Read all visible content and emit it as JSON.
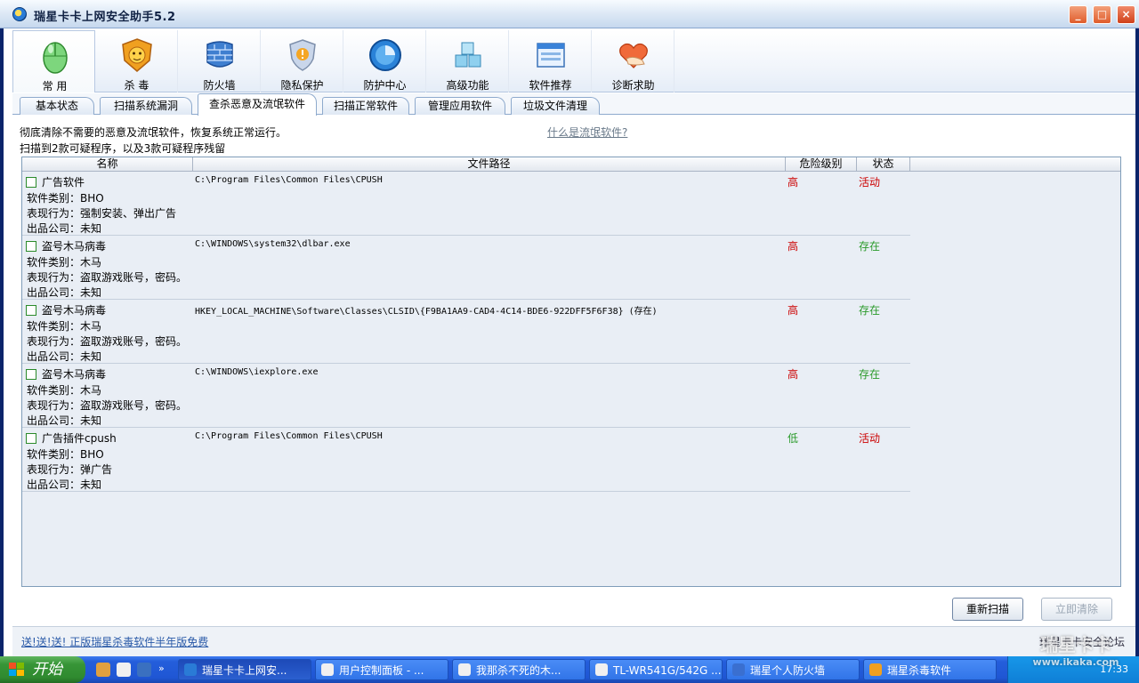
{
  "window": {
    "title": "瑞星卡卡上网安全助手5.2"
  },
  "toolbar": [
    {
      "label": "常  用",
      "icon": "mouse-icon"
    },
    {
      "label": "杀  毒",
      "icon": "lion-icon"
    },
    {
      "label": "防火墙",
      "icon": "firewall-icon"
    },
    {
      "label": "隐私保护",
      "icon": "shield-icon"
    },
    {
      "label": "防护中心",
      "icon": "globe-icon"
    },
    {
      "label": "高级功能",
      "icon": "cubes-icon"
    },
    {
      "label": "软件推荐",
      "icon": "window-icon"
    },
    {
      "label": "诊断求助",
      "icon": "heart-hand-icon"
    }
  ],
  "tabs": [
    {
      "label": "基本状态"
    },
    {
      "label": "扫描系统漏洞"
    },
    {
      "label": "查杀恶意及流氓软件",
      "active": true
    },
    {
      "label": "扫描正常软件"
    },
    {
      "label": "管理应用软件"
    },
    {
      "label": "垃圾文件清理"
    }
  ],
  "content": {
    "description": "彻底清除不需要的恶意及流氓软件，恢复系统正常运行。",
    "help_link": "什么是流氓软件?",
    "scan_summary": "扫描到2款可疑程序，以及3款可疑程序残留"
  },
  "table": {
    "headers": {
      "name": "名称",
      "path": "文件路径",
      "level": "危险级别",
      "state": "状态"
    },
    "rows": [
      {
        "name": "广告软件",
        "type": "软件类别：BHO",
        "behavior": "表现行为：强制安装、弹出广告",
        "company": "出品公司：未知",
        "path": "C:\\Program Files\\Common Files\\CPUSH",
        "level": "高",
        "state": "活动"
      },
      {
        "name": "盗号木马病毒",
        "type": "软件类别：木马",
        "behavior": "表现行为：盗取游戏账号，密码。",
        "company": "出品公司：未知",
        "path": "C:\\WINDOWS\\system32\\dlbar.exe",
        "level": "高",
        "state": "存在"
      },
      {
        "name": "盗号木马病毒",
        "type": "软件类别：木马",
        "behavior": "表现行为：盗取游戏账号，密码。",
        "company": "出品公司：未知",
        "path": "HKEY_LOCAL_MACHINE\\Software\\Classes\\CLSID\\{F9BA1AA9-CAD4-4C14-BDE6-922DFF5F6F38} (存在)",
        "level": "高",
        "state": "存在"
      },
      {
        "name": "盗号木马病毒",
        "type": "软件类别：木马",
        "behavior": "表现行为：盗取游戏账号，密码。",
        "company": "出品公司：未知",
        "path": "C:\\WINDOWS\\iexplore.exe",
        "level": "高",
        "state": "存在"
      },
      {
        "name": "广告插件cpush",
        "type": "软件类别：BHO",
        "behavior": "表现行为：弹广告",
        "company": "出品公司：未知",
        "path": "C:\\Program Files\\Common Files\\CPUSH",
        "level": "低",
        "state": "活动"
      }
    ]
  },
  "buttons": {
    "rescan": "重新扫描",
    "clean": "立即清除"
  },
  "footer": {
    "promo": "送!送!送! 正版瑞星杀毒软件半年版免费",
    "forum": "瑞星卡卡安全论坛"
  },
  "taskbar": {
    "start": "开始",
    "tasks": [
      {
        "label": "瑞星卡卡上网安..."
      },
      {
        "label": "用户控制面板 - ..."
      },
      {
        "label": "我那杀不死的木..."
      },
      {
        "label": "TL-WR541G/542G ..."
      },
      {
        "label": "瑞星个人防火墙"
      },
      {
        "label": "瑞星杀毒软件"
      }
    ],
    "clock": "17:33"
  },
  "watermark": {
    "title": "瑞星卡卡",
    "url": "www.ikaka.com"
  }
}
